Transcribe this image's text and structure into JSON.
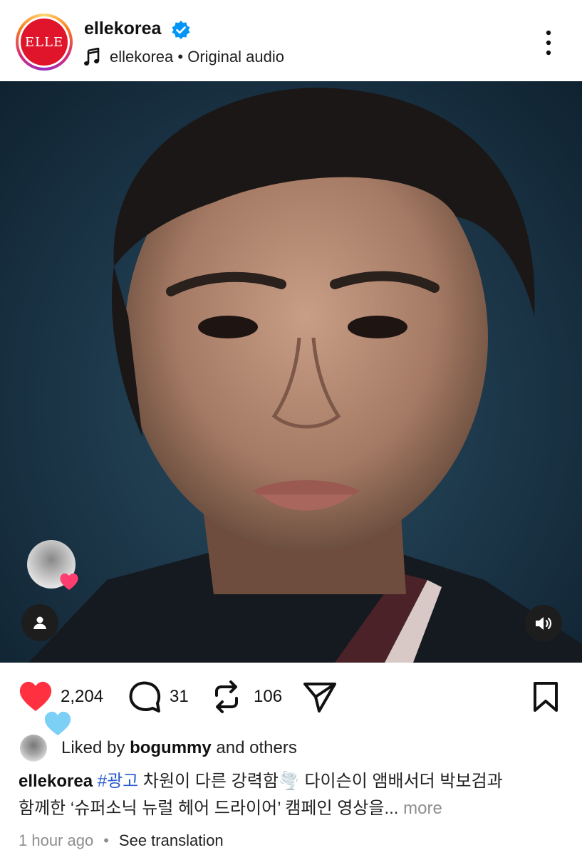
{
  "header": {
    "account_name": "ellekorea",
    "avatar_logo_text": "ELLE",
    "audio_label": "ellekorea • Original audio",
    "icons": {
      "verified": "verified-badge-icon",
      "music": "music-note-icon",
      "more": "more-options-icon"
    }
  },
  "media": {
    "icons": {
      "user_tag": "user-tag-icon",
      "volume": "volume-icon",
      "heart_badge": "heart-icon"
    }
  },
  "actions": {
    "likes": "2,204",
    "comments": "31",
    "reposts": "106",
    "icons": {
      "like": "heart-icon",
      "comment": "comment-icon",
      "repost": "repost-icon",
      "share": "send-icon",
      "save": "bookmark-icon"
    }
  },
  "liked_by": {
    "prefix": "Liked by ",
    "user": "bogummy",
    "suffix": " and others"
  },
  "caption": {
    "username": "ellekorea",
    "hashtag": "#광고",
    "text_line1": " 차원이 다른 강력함🌪️ 다이슨이 앰배서더 박보검과",
    "text_line2": "함께한 ‘슈퍼소닉 뉴럴 헤어 드라이어’ 캠페인 영상을",
    "ellipsis": "...",
    "more": " more"
  },
  "footer": {
    "time": "1 hour ago",
    "separator": "•",
    "translate": "See translation"
  },
  "colors": {
    "like_red": "#ff3040",
    "hashtag_blue": "#2b5bcd",
    "verified_blue": "#0095f6",
    "muted_gray": "#8e8e8e"
  }
}
